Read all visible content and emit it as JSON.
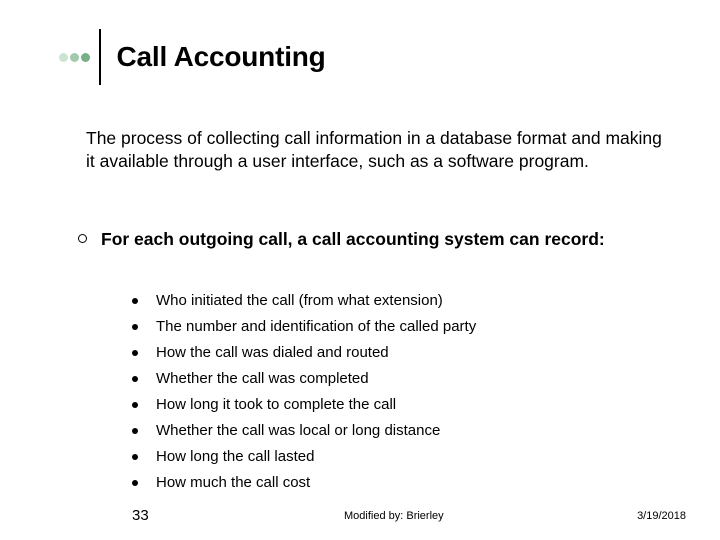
{
  "title": "Call Accounting",
  "intro": "The process of collecting call information in a database format and making it available through a user interface, such as a software program.",
  "section_heading": "For each outgoing call, a call accounting system can record:",
  "sub_items": [
    "Who initiated the call (from what extension)",
    "The number and identification of the called party",
    "How the call was dialed and routed",
    "Whether the call was completed",
    "How long it took to complete the call",
    "Whether the call was local or long distance",
    "How long the call lasted",
    "How much the call cost"
  ],
  "footer": {
    "slide_number": "33",
    "modified_by": "Modified by: Brierley",
    "date": "3/19/2018"
  }
}
